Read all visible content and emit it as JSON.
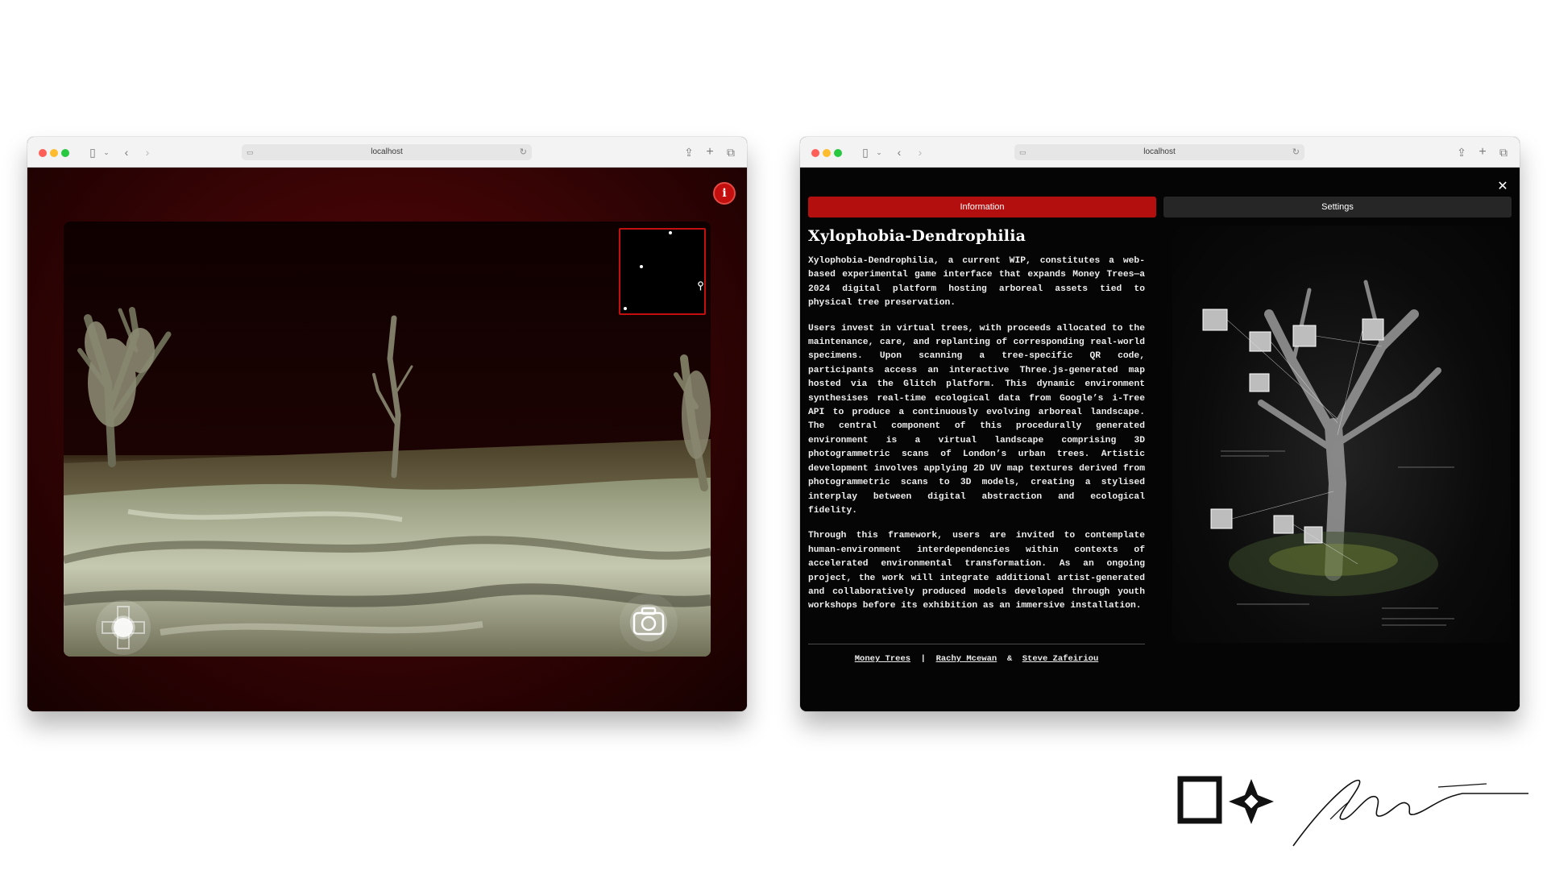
{
  "left_window": {
    "url": "localhost",
    "minimap_dots": 3
  },
  "right_window": {
    "url": "localhost",
    "tabs": [
      {
        "label": "Information",
        "active": true
      },
      {
        "label": "Settings",
        "active": false
      }
    ],
    "title": "Xylophobia-Dendrophilia",
    "paragraphs": [
      "Xylophobia-Dendrophilia, a current WIP, constitutes a web-based experimental game interface that expands Money Trees—a 2024 digital platform hosting arboreal assets tied to physical tree preservation.",
      "Users invest in virtual trees, with proceeds allocated to the maintenance, care, and replanting of corresponding real-world specimens. Upon scanning a tree-specific QR code, participants access an interactive Three.js-generated map hosted via the Glitch platform. This dynamic environment synthesises real-time ecological data from Google’s i-Tree API to produce a continuously evolving arboreal landscape. The central component of this procedurally generated environment is a virtual landscape comprising 3D photogrammetric scans of London’s urban trees. Artistic development involves applying 2D UV map textures derived from photogrammetric scans to 3D models, creating a stylised interplay between digital abstraction and ecological fidelity.",
      "Through this framework, users are invited to contemplate human-environment interdependencies within contexts of accelerated environmental transformation. As an ongoing project, the work will integrate additional artist-generated and collaboratively produced models developed through youth workshops before its exhibition as an immersive installation."
    ],
    "credits": {
      "link1": "Money Trees",
      "sep1": "|",
      "link2": "Rachy Mcewan",
      "sep2": "&",
      "link3": "Steve Zafeiriou"
    }
  },
  "icons": {
    "info": "info-icon",
    "close": "close-icon",
    "camera": "camera-icon",
    "joystick": "joystick-icon"
  },
  "colors": {
    "accent_red": "#c3100f",
    "tab_inactive": "#262626"
  }
}
